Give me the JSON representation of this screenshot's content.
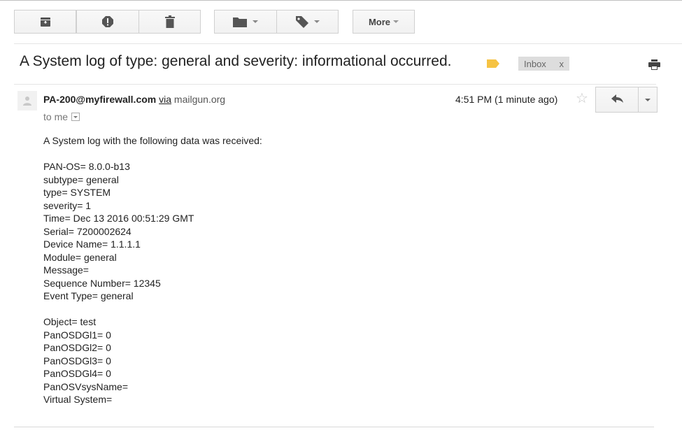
{
  "toolbar": {
    "archive_icon": "archive-icon",
    "report_spam_icon": "report-spam-icon",
    "delete_icon": "delete-icon",
    "move_to_icon": "folder-icon",
    "labels_icon": "label-icon",
    "more_label": "More"
  },
  "subject": {
    "text": "A System log of type: general and severity: informational occurred.",
    "important_marker_color": "#f6c343",
    "inbox_chip": "Inbox",
    "inbox_remove": "x"
  },
  "message": {
    "sender_name": "PA-200@myfirewall.com",
    "via": "via",
    "via_domain": "mailgun.org",
    "recipient": "to me",
    "time": "4:51 PM (1 minute ago)",
    "intro": "A System log with the following data was received:",
    "lines_group1": [
      "PAN-OS= 8.0.0-b13",
      "subtype= general",
      "type= SYSTEM",
      "severity= 1",
      "Time= Dec 13 2016 00:51:29 GMT",
      "Serial= 7200002624",
      "Device Name= 1.1.1.1",
      "Module= general",
      "Message=",
      "Sequence Number= 12345",
      "Event Type= general"
    ],
    "lines_group2": [
      "Object= test",
      "PanOSDGl1= 0",
      "PanOSDGl2= 0",
      "PanOSDGl3= 0",
      "PanOSDGl4= 0",
      "PanOSVsysName=",
      "Virtual System="
    ]
  }
}
